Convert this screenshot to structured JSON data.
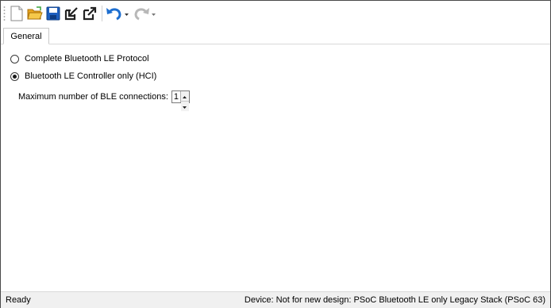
{
  "toolbar": {
    "buttons": [
      {
        "icon": "new-document-icon"
      },
      {
        "icon": "open-folder-icon"
      },
      {
        "icon": "save-icon"
      },
      {
        "icon": "import-icon"
      },
      {
        "icon": "export-icon"
      },
      {
        "icon": "undo-icon"
      },
      {
        "icon": "redo-icon"
      }
    ]
  },
  "tabs": [
    {
      "label": "General",
      "active": true
    }
  ],
  "options": {
    "radio_full": {
      "label": "Complete Bluetooth LE Protocol",
      "checked": false
    },
    "radio_hci": {
      "label": "Bluetooth LE Controller only (HCI)",
      "checked": true
    },
    "max_connections": {
      "label": "Maximum number of BLE connections:",
      "value": "1"
    }
  },
  "status": {
    "left": "Ready",
    "right": "Device: Not for new design: PSoC Bluetooth LE only Legacy Stack (PSoC 63)"
  },
  "colors": {
    "accent_blue": "#1e5fbf",
    "folder_yellow": "#f2b92a"
  }
}
